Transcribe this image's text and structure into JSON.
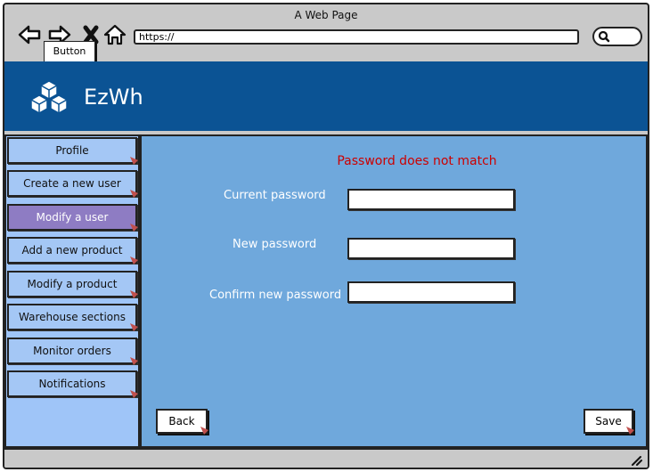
{
  "window": {
    "title": "A Web Page"
  },
  "browser": {
    "tooltip": "Button",
    "url": "https://"
  },
  "header": {
    "brand": "EzWh",
    "color": "#0b5394"
  },
  "sidebar": {
    "items": [
      {
        "label": "Profile",
        "active": false
      },
      {
        "label": "Create a new user",
        "active": false
      },
      {
        "label": "Modify a user",
        "active": true
      },
      {
        "label": "Add a new product",
        "active": false
      },
      {
        "label": "Modify a product",
        "active": false
      },
      {
        "label": "Warehouse sections",
        "active": false
      },
      {
        "label": "Monitor orders",
        "active": false
      },
      {
        "label": "Notifications",
        "active": false
      }
    ]
  },
  "main": {
    "error": "Password does not match",
    "fields": [
      {
        "label": "Current password",
        "value": ""
      },
      {
        "label": "New password",
        "value": ""
      },
      {
        "label": "Confirm new password",
        "value": ""
      }
    ],
    "back_label": "Back",
    "save_label": "Save"
  },
  "colors": {
    "error": "#cc0000",
    "active_item": "#8e7cc3",
    "sidebar": "#9fc5f8",
    "main": "#6fa8dc"
  },
  "icons": [
    "back-arrow-icon",
    "forward-arrow-icon",
    "close-icon",
    "home-icon",
    "search-icon",
    "cubes-logo-icon",
    "resize-grip-icon"
  ]
}
